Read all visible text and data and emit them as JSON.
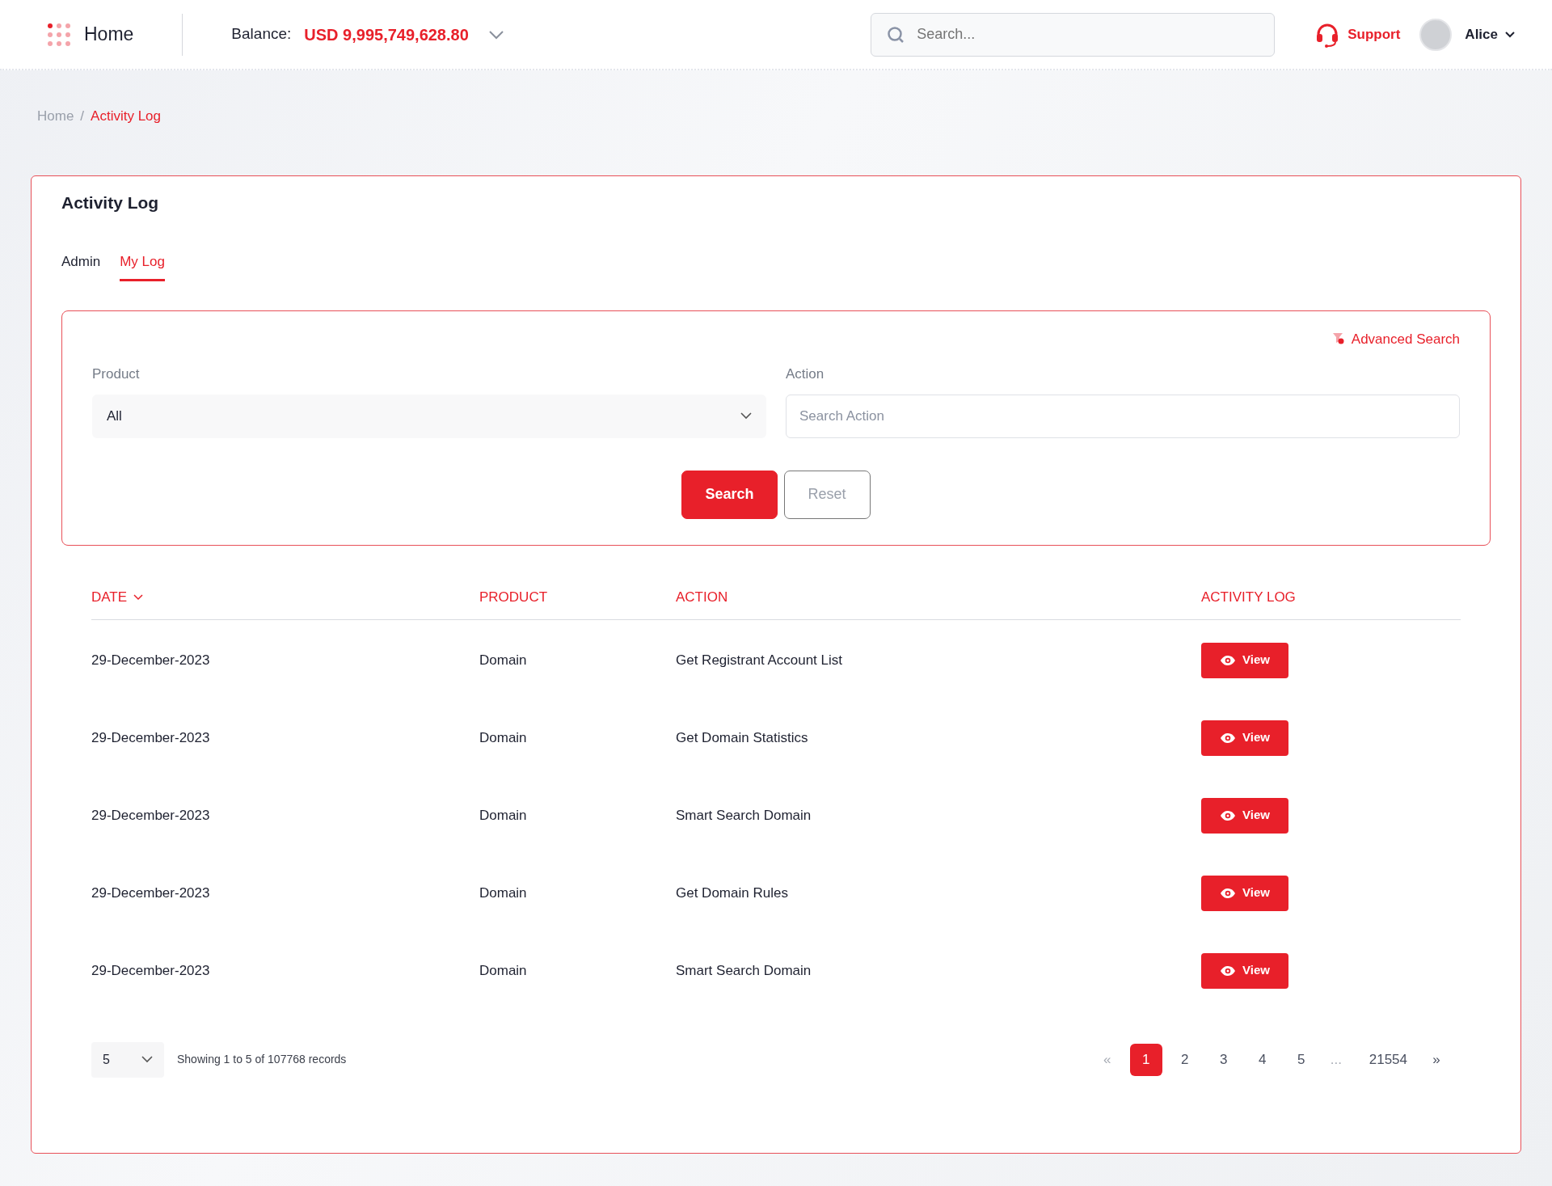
{
  "header": {
    "title": "Home",
    "balance_label": "Balance:",
    "balance_value": "USD 9,995,749,628.80",
    "search": {
      "placeholder": "Search..."
    },
    "support": "Support",
    "user": "Alice"
  },
  "breadcrumb": {
    "separator": "/",
    "items": [
      {
        "label": "Home",
        "selected": false
      },
      {
        "label": "Activity Log",
        "selected": true
      }
    ]
  },
  "card": {
    "title": "Activity Log",
    "tabs": [
      {
        "label": "Admin",
        "selected": false
      },
      {
        "label": "My Log",
        "selected": true
      }
    ],
    "filters": {
      "advanced_search": "Advanced Search",
      "fields": [
        {
          "kind": "select",
          "label": "Product",
          "value": "All"
        },
        {
          "kind": "text",
          "label": "Action",
          "placeholder": "Search Action"
        }
      ],
      "buttons": [
        {
          "kind": "primary",
          "label": "Search"
        },
        {
          "kind": "outline",
          "label": "Reset"
        }
      ]
    },
    "table": {
      "columns": [
        {
          "label": "DATE",
          "sorted": true
        },
        {
          "label": "PRODUCT",
          "sorted": false
        },
        {
          "label": "ACTION",
          "sorted": false
        },
        {
          "label": "ACTIVITY LOG",
          "sorted": false
        }
      ],
      "rows": [
        {
          "date": "29-December-2023",
          "product": "Domain",
          "action": "Get Registrant Account List",
          "view": "View"
        },
        {
          "date": "29-December-2023",
          "product": "Domain",
          "action": "Get Domain Statistics",
          "view": "View"
        },
        {
          "date": "29-December-2023",
          "product": "Domain",
          "action": "Smart Search Domain",
          "view": "View"
        },
        {
          "date": "29-December-2023",
          "product": "Domain",
          "action": "Get Domain Rules",
          "view": "View"
        },
        {
          "date": "29-December-2023",
          "product": "Domain",
          "action": "Smart Search Domain",
          "view": "View"
        }
      ]
    },
    "pagination": {
      "page_size": "5",
      "info": "Showing 1 to 5 of 107768 records",
      "pages": [
        {
          "kind": "prev",
          "label": "«",
          "selected": false
        },
        {
          "kind": "page",
          "label": "1",
          "selected": true
        },
        {
          "kind": "page",
          "label": "2",
          "selected": false
        },
        {
          "kind": "page",
          "label": "3",
          "selected": false
        },
        {
          "kind": "page",
          "label": "4",
          "selected": false
        },
        {
          "kind": "page",
          "label": "5",
          "selected": false
        },
        {
          "kind": "ellipsis",
          "label": "...",
          "selected": false
        },
        {
          "kind": "page",
          "label": "21554",
          "selected": false
        },
        {
          "kind": "next",
          "label": "»",
          "selected": false
        }
      ]
    }
  }
}
